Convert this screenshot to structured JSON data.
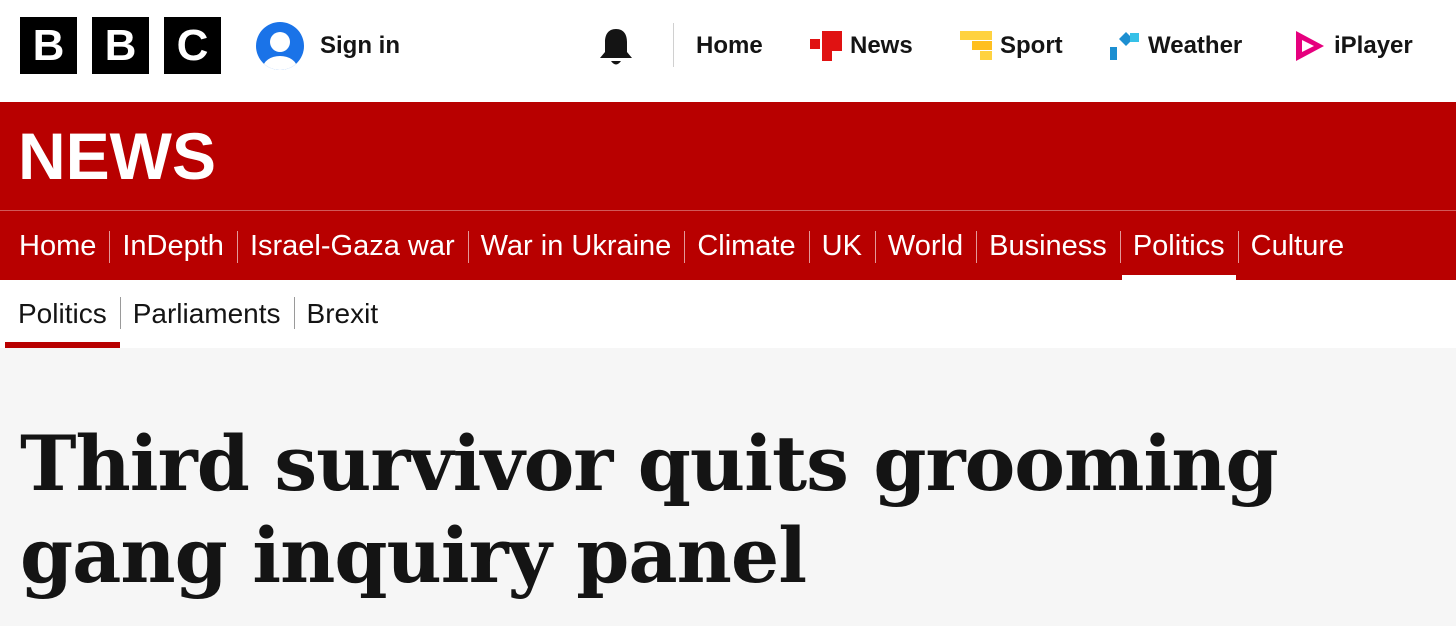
{
  "header": {
    "logo_letters": [
      "B",
      "B",
      "C"
    ],
    "sign_in_label": "Sign in",
    "nav": [
      {
        "label": "Home",
        "icon": "none"
      },
      {
        "label": "News",
        "icon": "news-icon"
      },
      {
        "label": "Sport",
        "icon": "sport-icon"
      },
      {
        "label": "Weather",
        "icon": "weather-icon"
      },
      {
        "label": "iPlayer",
        "icon": "iplayer-icon"
      }
    ]
  },
  "masthead": {
    "title": "NEWS"
  },
  "section_nav": {
    "items": [
      {
        "label": "Home"
      },
      {
        "label": "InDepth"
      },
      {
        "label": "Israel-Gaza war"
      },
      {
        "label": "War in Ukraine"
      },
      {
        "label": "Climate"
      },
      {
        "label": "UK"
      },
      {
        "label": "World"
      },
      {
        "label": "Business"
      },
      {
        "label": "Politics",
        "active": true
      },
      {
        "label": "Culture"
      }
    ]
  },
  "sub_nav": {
    "items": [
      {
        "label": "Politics",
        "active": true
      },
      {
        "label": "Parliaments"
      },
      {
        "label": "Brexit"
      }
    ]
  },
  "article": {
    "headline": "Third survivor quits grooming gang inquiry panel"
  },
  "colors": {
    "brand_red": "#b80000",
    "page_background": "#f6f6f6",
    "avatar_blue": "#1a73e8",
    "news_icon_red": "#e01212",
    "sport_icon_yellow": "#ffd23f",
    "weather_icon_blue": "#1d8fd1",
    "iplayer_icon_pink": "#e6007e"
  }
}
